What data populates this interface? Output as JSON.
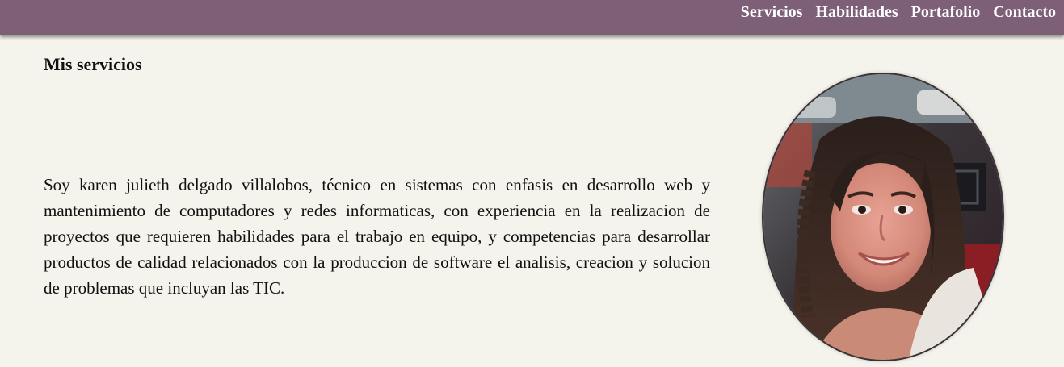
{
  "nav": {
    "items": [
      {
        "label": "Servicios"
      },
      {
        "label": "Habilidades"
      },
      {
        "label": "Portafolio"
      },
      {
        "label": "Contacto"
      }
    ]
  },
  "main": {
    "title": "Mis servicios",
    "bio": "Soy karen julieth delgado villalobos, técnico en sistemas con enfasis en desarrollo web y mantenimiento de computadores y redes informaticas, con experiencia en la realizacion de proyectos que requieren habilidades para el trabajo en equipo, y competencias para desarrollar productos de calidad relacionados con la produccion de software el analisis, creacion y solucion de problemas que incluyan las TIC."
  },
  "colors": {
    "header": "#7d5f77",
    "background": "#f5f4ec",
    "nav_text": "#ffffff"
  }
}
